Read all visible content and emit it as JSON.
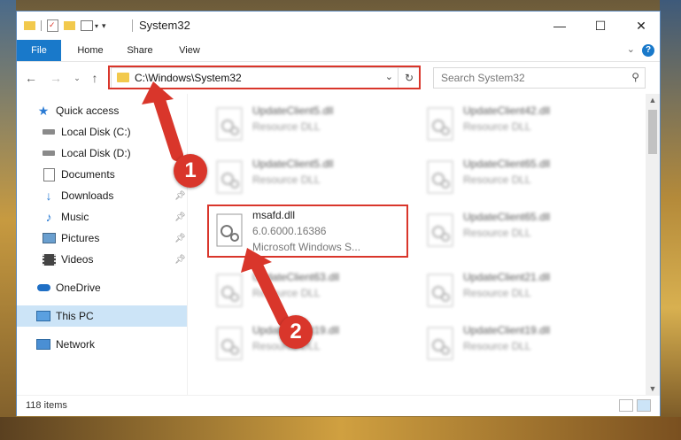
{
  "window": {
    "title": "System32",
    "controls": {
      "minimize": "—",
      "maximize": "☐",
      "close": "✕"
    }
  },
  "ribbon": {
    "tabs": [
      {
        "label": "File",
        "active": true
      },
      {
        "label": "Home"
      },
      {
        "label": "Share"
      },
      {
        "label": "View"
      }
    ],
    "help_label": "?"
  },
  "address_bar": {
    "path": "C:\\Windows\\System32"
  },
  "search": {
    "placeholder": "Search System32"
  },
  "sidebar": {
    "items": [
      {
        "label": "Quick access",
        "icon": "star-icon",
        "pinned": false
      },
      {
        "label": "Local Disk (C:)",
        "icon": "drive-icon",
        "pinned": false
      },
      {
        "label": "Local Disk (D:)",
        "icon": "drive-icon",
        "pinned": false
      },
      {
        "label": "Documents",
        "icon": "documents-icon",
        "pinned": true
      },
      {
        "label": "Downloads",
        "icon": "download-icon",
        "pinned": true
      },
      {
        "label": "Music",
        "icon": "music-icon",
        "pinned": true
      },
      {
        "label": "Pictures",
        "icon": "pictures-icon",
        "pinned": true
      },
      {
        "label": "Videos",
        "icon": "videos-icon",
        "pinned": true
      },
      {
        "label": "OneDrive",
        "icon": "cloud-icon",
        "pinned": false
      },
      {
        "label": "This PC",
        "icon": "pc-icon",
        "pinned": false,
        "selected": true
      },
      {
        "label": "Network",
        "icon": "network-icon",
        "pinned": false
      }
    ]
  },
  "files": [
    {
      "name": "UpdateClient5.dll",
      "type": "Resource DLL",
      "blurred": true
    },
    {
      "name": "UpdateClient42.dll",
      "type": "Resource DLL",
      "blurred": true
    },
    {
      "name": "UpdateClient5.dll",
      "type": "Resource DLL",
      "blurred": true
    },
    {
      "name": "UpdateClient65.dll",
      "type": "Resource DLL",
      "blurred": true
    },
    {
      "name": "msafd.dll",
      "version": "6.0.6000.16386",
      "description": "Microsoft Windows S...",
      "blurred": false
    },
    {
      "name": "UpdateClient65.dll",
      "type": "Resource DLL",
      "blurred": true
    },
    {
      "name": "UpdateClient63.dll",
      "type": "Resource DLL",
      "blurred": true
    },
    {
      "name": "UpdateClient21.dll",
      "type": "Resource DLL",
      "blurred": true
    },
    {
      "name": "UpdateClient19.dll",
      "type": "Resource DLL",
      "blurred": true
    },
    {
      "name": "UpdateClient19.dll",
      "type": "Resource DLL",
      "blurred": true
    }
  ],
  "status": {
    "item_count": "118 items"
  },
  "annotations": {
    "badge_1": "1",
    "badge_2": "2",
    "highlight_color": "#d9362b"
  }
}
